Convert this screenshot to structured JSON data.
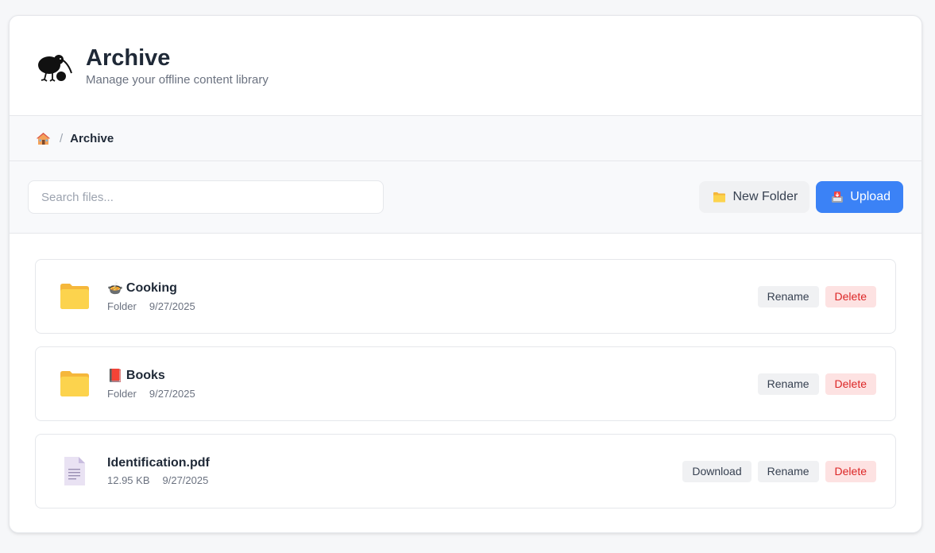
{
  "header": {
    "title": "Archive",
    "subtitle": "Manage your offline content library",
    "logo_icon": "kiwi-bird-icon"
  },
  "breadcrumb": {
    "home_icon": "home-icon",
    "separator": "/",
    "current": "Archive"
  },
  "toolbar": {
    "search_placeholder": "Search files...",
    "new_folder_label": "New Folder",
    "new_folder_icon": "folder-icon",
    "upload_label": "Upload",
    "upload_icon": "inbox-tray-icon",
    "upload_color": "#3b82f6"
  },
  "items": [
    {
      "type": "folder",
      "emoji": "🍲",
      "name": "Cooking",
      "meta_primary": "Folder",
      "date": "9/27/2025",
      "actions": {
        "rename": "Rename",
        "delete": "Delete"
      }
    },
    {
      "type": "folder",
      "emoji": "📕",
      "name": "Books",
      "meta_primary": "Folder",
      "date": "9/27/2025",
      "actions": {
        "rename": "Rename",
        "delete": "Delete"
      }
    },
    {
      "type": "file",
      "name": "Identification.pdf",
      "meta_primary": "12.95 KB",
      "date": "9/27/2025",
      "actions": {
        "download": "Download",
        "rename": "Rename",
        "delete": "Delete"
      }
    }
  ],
  "colors": {
    "accent": "#3b82f6",
    "danger_bg": "#fde2e2",
    "danger_text": "#dc2626",
    "folder": "#fbbf24"
  }
}
